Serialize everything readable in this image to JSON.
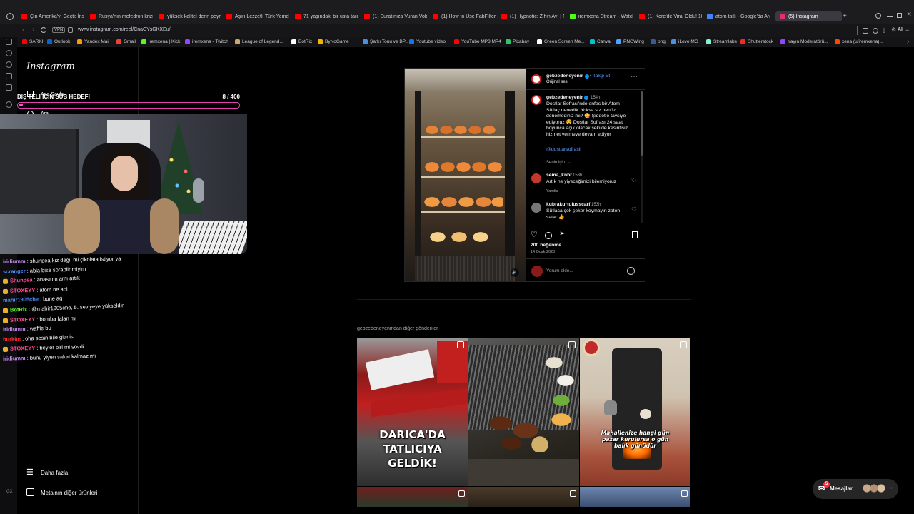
{
  "browser": {
    "tabs": [
      {
        "label": "Çin Amerika'yı Geçti: İnsan",
        "color": "#ff0000"
      },
      {
        "label": "Rusya'nın mefedron krizi",
        "color": "#ff0000"
      },
      {
        "label": "yüksek kalitel derin peyna",
        "color": "#ff0000"
      },
      {
        "label": "Aşırı Lezzetli Türk Yemek",
        "color": "#ff0000"
      },
      {
        "label": "71 yaşındaki bir usta tara",
        "color": "#ff0000"
      },
      {
        "label": "(1) Suratınıza Vuran Vokal",
        "color": "#ff0000"
      },
      {
        "label": "(1) How to Use FabFilter P",
        "color": "#ff0000"
      },
      {
        "label": "(1) Hypnotic: Zihin Avı | Tü",
        "color": "#ff0000"
      },
      {
        "label": "iremxena Stream - Watch",
        "color": "#53fc18"
      },
      {
        "label": "(1) Kore'de Viral Oldu! 10",
        "color": "#ff0000"
      },
      {
        "label": "atom tatlı - Google'da Ara",
        "color": "#4285f4"
      },
      {
        "label": "(5) Instagram",
        "color": "#e1306c",
        "active": true
      }
    ],
    "url": "www.instagram.com/reel/CnaCYsGKXEu/",
    "bookmarks": [
      {
        "label": "ŞARKI",
        "color": "#ff0000"
      },
      {
        "label": "Outlook",
        "color": "#0a64d8"
      },
      {
        "label": "Yandex Mail",
        "color": "#ff9900"
      },
      {
        "label": "Gmail",
        "color": "#ea4335"
      },
      {
        "label": "iremxena | Kick",
        "color": "#53fc18"
      },
      {
        "label": "iremxena - Twitch",
        "color": "#9146ff"
      },
      {
        "label": "League of Legend...",
        "color": "#c8aa6e"
      },
      {
        "label": "BotRix",
        "color": "#ffffff"
      },
      {
        "label": "ByNoGame",
        "color": "#f4b400"
      },
      {
        "label": "Şarkı Tonu ve BP...",
        "color": "#4a90e2"
      },
      {
        "label": "Youtube video",
        "color": "#1a73e8"
      },
      {
        "label": "YouTube MP3 MP4",
        "color": "#ff0000"
      },
      {
        "label": "Pixabay",
        "color": "#2ec66d"
      },
      {
        "label": "Green Screen Me...",
        "color": "#ffffff"
      },
      {
        "label": "Canva",
        "color": "#00c4cc"
      },
      {
        "label": "PNGWing",
        "color": "#4aa3ff"
      },
      {
        "label": "png",
        "color": "#3b5998"
      },
      {
        "label": "iLoveIMG",
        "color": "#4a90e2"
      },
      {
        "label": "Streamlabs",
        "color": "#80f5d2"
      },
      {
        "label": "Shutterstock",
        "color": "#ee2b24"
      },
      {
        "label": "Yayın Moderatörü...",
        "color": "#9146ff"
      },
      {
        "label": "xena (u/iremxena)...",
        "color": "#ff4500"
      }
    ]
  },
  "instagram": {
    "logo": "Instagram",
    "nav_more": "Daha fazla",
    "nav_meta": "Meta'nın diğer ürünleri",
    "nav_home": "Ana Sayfa",
    "nav_search": "Ara"
  },
  "overlay": {
    "goal_label": "DİŞ TELİ İÇİN SUB HEDEFİ",
    "goal_count": "8  / 400",
    "goal_fraction": 0.02,
    "chat": [
      {
        "user": "iridiumm",
        "msg": ": shunpea kız değil mi çikolata istiyor ya",
        "color": "#c58cf2"
      },
      {
        "user": "scranger",
        "msg": ": abla bise sorabilr miyim",
        "color": "#4a8cff"
      },
      {
        "user": "Shunpea",
        "msg": ": anasının amı artık",
        "color": "#ff4f91",
        "badge": true
      },
      {
        "user": "STOXEYY",
        "msg": ": atom ne abi",
        "color": "#ff4f91",
        "badge": true
      },
      {
        "user": "mahir1905che",
        "msg": ": bune aq",
        "color": "#4a8cff"
      },
      {
        "user": "BotRix",
        "msg": ": @mahir1905che, 5. seviyeye yükseldin",
        "color": "#53fc18",
        "badge": true
      },
      {
        "user": "STOXEYY",
        "msg": ": bomba falan mı",
        "color": "#ff4f91",
        "badge": true
      },
      {
        "user": "iridiumm",
        "msg": ": waffle bu",
        "color": "#c58cf2"
      },
      {
        "user": "burkim",
        "msg": ": oha sesin bile gitmis",
        "color": "#ff2e2e"
      },
      {
        "user": "STOXEYY",
        "msg": ": beyler biri mi sövdi",
        "color": "#ff4f91",
        "badge": true
      },
      {
        "user": "iridiumm",
        "msg": ": bunu yiyen sakat kalmaz mı",
        "color": "#c58cf2"
      }
    ]
  },
  "post": {
    "author": "gebzedeneyenir",
    "follow": "• Takip Et",
    "audio": "Orijinal ses",
    "caption_author": "gebzedeneyenir",
    "caption_time": "154h",
    "caption": "Dostlar Sofrası'nde enfes bir Atom Sütlaç denedik. Yoksa siz henüz denemediniz mi? 😋 Şiddetle tavsiye ediyoruz 😍 Dostlar Sofrası 24 saat boyunca açık olacak şekilde kesintisiz hizmet vermeye devam ediyor",
    "mention": "@dostlarsofrasii",
    "for_you": "Senin için",
    "comments": [
      {
        "user": "sema_knbr",
        "time": "153h",
        "text": "Artık ne yiyeceğimizi bilemiyoruz",
        "reply": "Yanıtla"
      },
      {
        "user": "kubrakurtulusscarf",
        "time": "153h",
        "text": "Sütlaca çok şeker koymayın zaten satar 👍",
        "reply": ""
      }
    ],
    "likes": "200 beğenme",
    "date": "14 Ocak 2023",
    "comment_placeholder": "Yorum ekle..."
  },
  "more_posts": {
    "title": "gebzedeneyenir'dan diğer gönderiler",
    "thumbs": [
      {
        "caption": "DARICA'DA TATLICIYA GELDİK!"
      },
      {
        "caption": ""
      },
      {
        "caption": "Mahallenize hangi gün pazar kurulursa o gün balık günüdür"
      }
    ]
  },
  "messages": {
    "label": "Mesajlar",
    "badge": "5"
  }
}
